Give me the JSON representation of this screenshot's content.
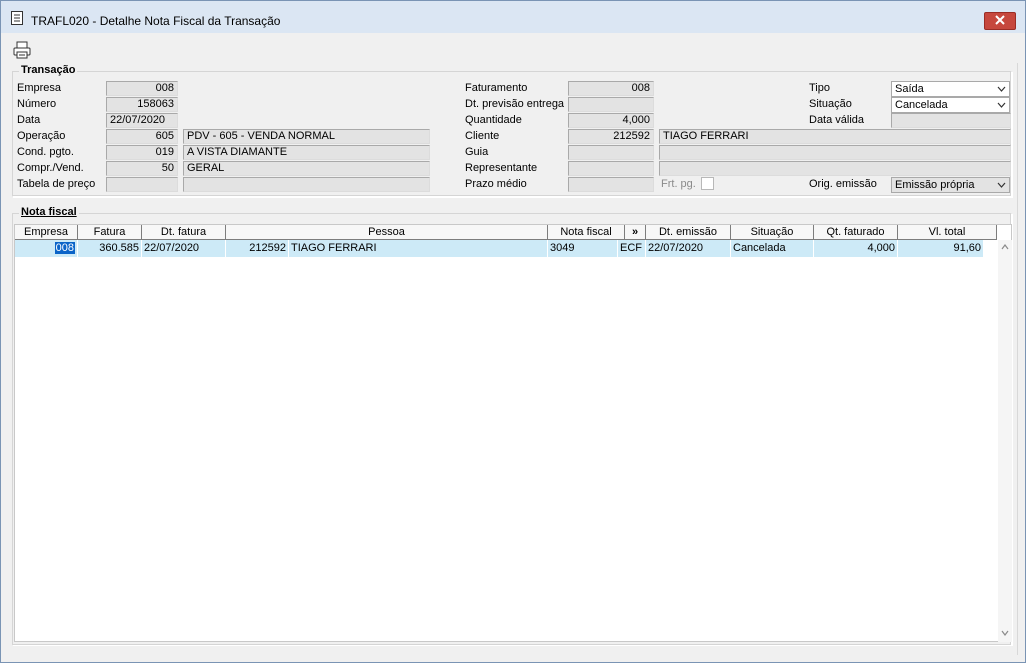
{
  "window": {
    "title": "TRAFL020 - Detalhe Nota Fiscal da Transação"
  },
  "transacao": {
    "legend": "Transação",
    "empresa": {
      "label": "Empresa",
      "value": "008"
    },
    "numero": {
      "label": "Número",
      "value": "158063"
    },
    "data": {
      "label": "Data",
      "value": "22/07/2020"
    },
    "operacao": {
      "label": "Operação",
      "code": "605",
      "desc": "PDV - 605 - VENDA NORMAL"
    },
    "cond_pgto": {
      "label": "Cond. pgto.",
      "code": "019",
      "desc": "A VISTA DIAMANTE"
    },
    "compr_vend": {
      "label": "Compr./Vend.",
      "code": "50",
      "desc": "GERAL"
    },
    "tabela_preco": {
      "label": "Tabela de preço",
      "code": "",
      "desc": ""
    },
    "faturamento": {
      "label": "Faturamento",
      "value": "008"
    },
    "dt_previsao": {
      "label": "Dt. previsão entrega",
      "value": ""
    },
    "quantidade": {
      "label": "Quantidade",
      "value": "4,000"
    },
    "cliente": {
      "label": "Cliente",
      "code": "212592",
      "desc": "TIAGO FERRARI"
    },
    "guia": {
      "label": "Guia",
      "code": "",
      "desc": ""
    },
    "representante": {
      "label": "Representante",
      "code": "",
      "desc": ""
    },
    "prazo_medio": {
      "label": "Prazo médio",
      "value": ""
    },
    "frt_pg": {
      "label": "Frt. pg."
    },
    "tipo": {
      "label": "Tipo",
      "value": "Saída"
    },
    "situacao": {
      "label": "Situação",
      "value": "Cancelada"
    },
    "data_valida": {
      "label": "Data válida",
      "value": ""
    },
    "orig_emissao": {
      "label": "Orig. emissão",
      "value": "Emissão própria"
    }
  },
  "nota_fiscal": {
    "legend": "Nota fiscal",
    "columns": {
      "empresa": "Empresa",
      "fatura": "Fatura",
      "dt_fatura": "Dt. fatura",
      "pessoa": "Pessoa",
      "nota_fiscal": "Nota fiscal",
      "more": "»",
      "dt_emissao": "Dt. emissão",
      "situacao": "Situação",
      "qt_faturado": "Qt. faturado",
      "vl_total": "Vl. total"
    },
    "rows": [
      {
        "empresa": "008",
        "fatura": "360.585",
        "dt_fatura": "22/07/2020",
        "pessoa_code": "212592",
        "pessoa_name": "TIAGO FERRARI",
        "nota_fiscal": "3049",
        "serie": "ECF",
        "dt_emissao": "22/07/2020",
        "situacao": "Cancelada",
        "qt_faturado": "4,000",
        "vl_total": "91,60"
      }
    ]
  },
  "icons": {
    "title": "document-icon",
    "close": "close-icon",
    "print": "printer-icon"
  },
  "colors": {
    "close_button": "#c6473d",
    "selected_row": "#cdeaf7",
    "selection": "#0a64c8"
  }
}
